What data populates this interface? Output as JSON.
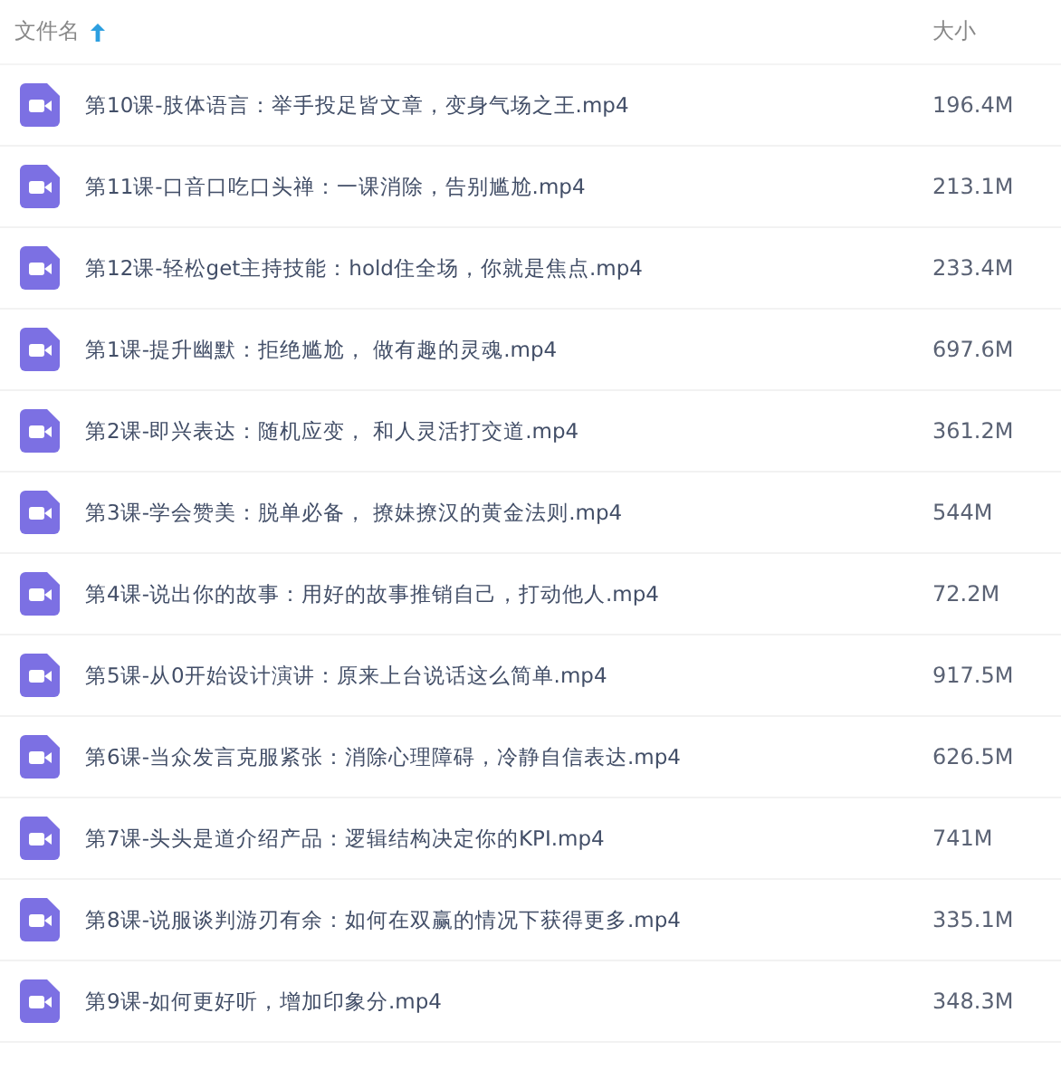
{
  "header": {
    "name_label": "文件名",
    "size_label": "大小"
  },
  "files": [
    {
      "name": "第10课-肢体语言：举手投足皆文章，变身气场之王.mp4",
      "size": "196.4M"
    },
    {
      "name": "第11课-口音口吃口头禅：一课消除，告别尴尬.mp4",
      "size": "213.1M"
    },
    {
      "name": "第12课-轻松get主持技能：hold住全场，你就是焦点.mp4",
      "size": "233.4M"
    },
    {
      "name": "第1课-提升幽默：拒绝尴尬， 做有趣的灵魂.mp4",
      "size": "697.6M"
    },
    {
      "name": "第2课-即兴表达：随机应变， 和人灵活打交道.mp4",
      "size": "361.2M"
    },
    {
      "name": "第3课-学会赞美：脱单必备， 撩妹撩汉的黄金法则.mp4",
      "size": "544M"
    },
    {
      "name": "第4课-说出你的故事：用好的故事推销自己，打动他人.mp4",
      "size": "72.2M"
    },
    {
      "name": "第5课-从0开始设计演讲：原来上台说话这么简单.mp4",
      "size": "917.5M"
    },
    {
      "name": "第6课-当众发言克服紧张：消除心理障碍，冷静自信表达.mp4",
      "size": "626.5M"
    },
    {
      "name": "第7课-头头是道介绍产品：逻辑结构决定你的KPI.mp4",
      "size": "741M"
    },
    {
      "name": "第8课-说服谈判游刃有余：如何在双赢的情况下获得更多.mp4",
      "size": "335.1M"
    },
    {
      "name": "第9课-如何更好听，增加印象分.mp4",
      "size": "348.3M"
    }
  ]
}
